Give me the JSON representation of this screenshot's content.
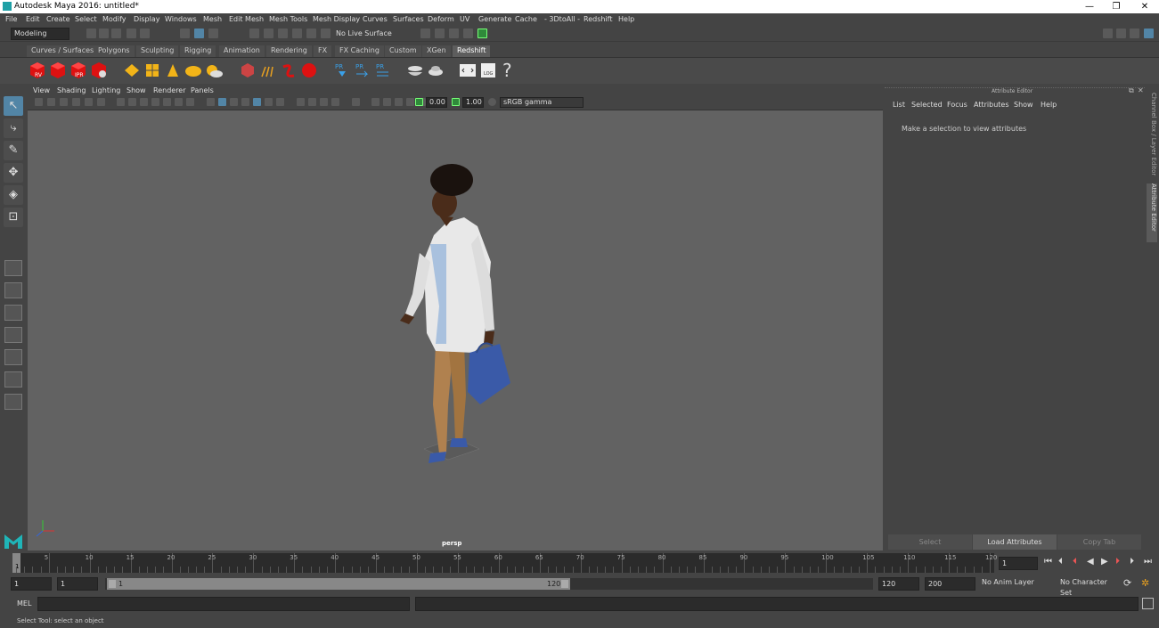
{
  "window": {
    "title": "Autodesk Maya 2016: untitled*",
    "minimize": "—",
    "restore": "❐",
    "close": "✕"
  },
  "menubar": [
    "File",
    "Edit",
    "Create",
    "Select",
    "Modify",
    "Display",
    "Windows",
    "Mesh",
    "Edit Mesh",
    "Mesh Tools",
    "Mesh Display",
    "Curves",
    "Surfaces",
    "Deform",
    "UV",
    "Generate",
    "Cache",
    "- 3DtoAll -",
    "Redshift",
    "Help"
  ],
  "statusline": {
    "mode": "Modeling",
    "live_surface": "No Live Surface"
  },
  "shelf_tabs": [
    "Curves / Surfaces",
    "Polygons",
    "Sculpting",
    "Rigging",
    "Animation",
    "Rendering",
    "FX",
    "FX Caching",
    "Custom",
    "XGen",
    "Redshift"
  ],
  "shelf_active": "Redshift",
  "shelf_icons": {
    "rv": "RV",
    "ipr": "IPR",
    "pr": "PR",
    "log": "LOG",
    "help": "?"
  },
  "viewport_menu": [
    "View",
    "Shading",
    "Lighting",
    "Show",
    "Renderer",
    "Panels"
  ],
  "viewport_bar": {
    "exposure": "0.00",
    "gamma": "1.00",
    "colorspace": "sRGB gamma"
  },
  "viewport": {
    "camera_label": "persp"
  },
  "attribute_editor": {
    "title": "Attribute Editor",
    "menu": [
      "List",
      "Selected",
      "Focus",
      "Attributes",
      "Show",
      "Help"
    ],
    "message": "Make a selection to view attributes",
    "buttons": {
      "select": "Select",
      "load": "Load Attributes",
      "copy": "Copy Tab"
    }
  },
  "side_tabs": {
    "channel_box": "Channel Box / Layer Editor",
    "attribute_editor": "Attribute Editor"
  },
  "timeline": {
    "ticks": [
      "5",
      "10",
      "15",
      "20",
      "25",
      "30",
      "35",
      "40",
      "45",
      "50",
      "55",
      "60",
      "65",
      "70",
      "75",
      "80",
      "85",
      "90",
      "95",
      "100",
      "105",
      "110",
      "115",
      "120"
    ],
    "current_frame": "1",
    "start_label": "1"
  },
  "range": {
    "start": "1",
    "anim_start": "1",
    "slider_start": "1",
    "slider_end": "120",
    "end": "120",
    "anim_end": "200",
    "anim_layer": "No Anim Layer",
    "char_set": "No Character Set"
  },
  "command": {
    "lang": "MEL"
  },
  "help_line": "Select Tool: select an object"
}
